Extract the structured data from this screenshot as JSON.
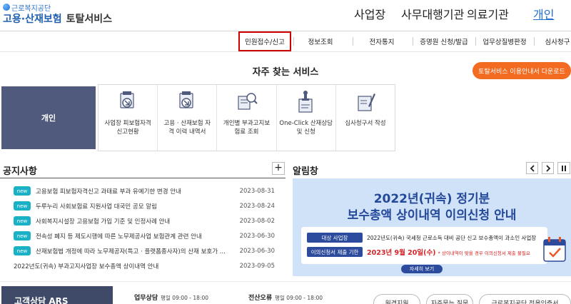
{
  "logo": {
    "org": "근로복지공단",
    "brand": "고용·산재보험",
    "suffix": "토탈서비스"
  },
  "top_nav": [
    {
      "label": "사업장",
      "active": false
    },
    {
      "label": "사무대행기관",
      "active": false
    },
    {
      "label": "의료기관",
      "active": false
    },
    {
      "label": "개인",
      "active": true
    }
  ],
  "submenu": [
    "민원접수/신고",
    "정보조회",
    "전자통지",
    "증명원 신청/발급",
    "업무상질병판정",
    "심사청구"
  ],
  "favorites": {
    "title": "자주 찾는 서비스",
    "guide_button": "토탈서비스 이용안내서 다운로드",
    "persona": "개인",
    "services": [
      {
        "icon": "report-icon",
        "label": "사업장 피보험자격\n신고현황"
      },
      {
        "icon": "history-icon",
        "label": "고용 · 산재보험 자\n격 이력 내역서"
      },
      {
        "icon": "search-doc-icon",
        "label": "개인별 부과고지보\n험료 조회"
      },
      {
        "icon": "stamp-icon",
        "label": "One-Click 산재상담\n및 신청"
      },
      {
        "icon": "pen-doc-icon",
        "label": "심사청구서 작성"
      }
    ]
  },
  "notices": {
    "title": "공지사항",
    "plus": "+",
    "items": [
      {
        "badge": "new",
        "text": "고용보험 피보험자격신고 과태료 부과 유예기한 변경 안내",
        "date": "2023-08-31"
      },
      {
        "badge": "new",
        "text": "두루누리 사회보험료 지원사업 대국민 공모 알림",
        "date": "2023-08-24"
      },
      {
        "badge": "new",
        "text": "사회복지시설장 고용보험 가입 기준 및 인정사례 안내",
        "date": "2023-08-02"
      },
      {
        "badge": "new",
        "text": "전속성 폐지 등 제도시행에 따른 노무제공사업 보험관계 관련 안내",
        "date": "2023-06-30"
      },
      {
        "badge": "new",
        "text": "산재보험법 개정에 따라 노무제공자(특고 · 플랫폼종사자)의 산재 보호가 ...",
        "date": "2023-06-30"
      },
      {
        "badge": "",
        "text": "2022년도(귀속) 부과고지사업장 보수총액 상이내역 안내",
        "date": "2023-09-05"
      }
    ]
  },
  "alert": {
    "title": "알림창",
    "banner_title_1": "2022년(귀속) 정기분",
    "banner_title_2": "보수총액 상이내역 이의신청 안내",
    "target_label": "대상 사업장",
    "target_text": "2022년도(귀속) 국세청 근로소득 대비 공단 신고 보수총액이 과소인 사업장",
    "deadline_label": "이의신청서 제출 기한",
    "deadline_date": "2023년 9월 20일(수)",
    "deadline_note": "* 상이내역이 맞을 경우 이의신청서 제출 불필요",
    "detail_button": "자세히 보기"
  },
  "bottom": {
    "consult_title": "고객상담 ARS",
    "hours": [
      {
        "label": "업무상담",
        "value": "평일 09:00 - 18:00"
      },
      {
        "label": "전산오류",
        "value": "평일 09:00 - 18:00"
      }
    ],
    "buttons": [
      "원격지원",
      "자주묻는 질문",
      "근로복지공단 전용인증서"
    ]
  },
  "colors": {
    "brand_blue": "#1f5fb0",
    "accent_orange": "#f26b21",
    "active_outline": "#cc0000",
    "badge_teal": "#1ab1c7",
    "banner_bg": "#cfe2f7",
    "banner_navy": "#24489a"
  }
}
